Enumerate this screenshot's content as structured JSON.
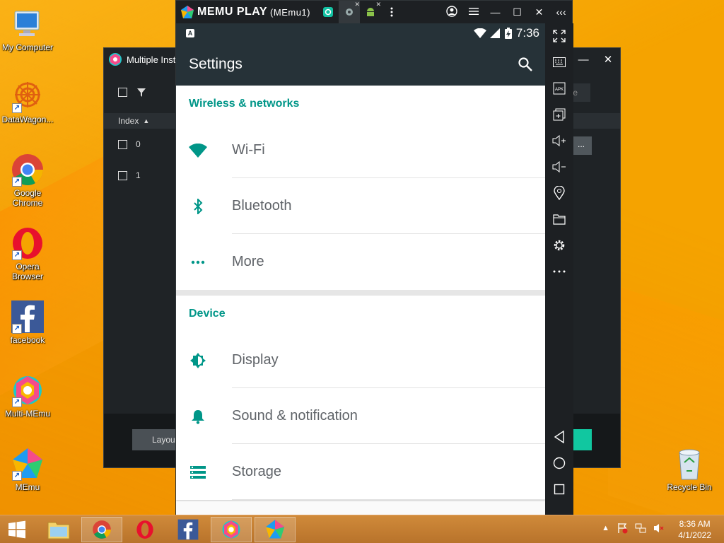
{
  "desktop": {
    "icons": [
      {
        "label": "My Computer"
      },
      {
        "label": "DataWagon..."
      },
      {
        "label": "Google Chrome"
      },
      {
        "label": "Opera Browser"
      },
      {
        "label": "facebook"
      },
      {
        "label": "Multi-MEmu"
      },
      {
        "label": "MEmu"
      },
      {
        "label": "Recycle Bin"
      }
    ]
  },
  "multi_window": {
    "title": "Multiple Insta",
    "column_index": "Index",
    "rows": [
      "0",
      "1"
    ],
    "layout_button": "Layout",
    "search_fragment": "te",
    "dots_button": "..."
  },
  "memu": {
    "brand": "MEMU PLAY",
    "instance": "(MEmu1)"
  },
  "android": {
    "status_time": "7:36",
    "status_badge": "A",
    "app_title": "Settings",
    "sections": [
      {
        "title": "Wireless & networks",
        "items": [
          {
            "label": "Wi-Fi",
            "icon": "wifi-icon"
          },
          {
            "label": "Bluetooth",
            "icon": "bluetooth-icon"
          },
          {
            "label": "More",
            "icon": "more-dots-icon"
          }
        ]
      },
      {
        "title": "Device",
        "items": [
          {
            "label": "Display",
            "icon": "brightness-icon"
          },
          {
            "label": "Sound & notification",
            "icon": "bell-icon"
          },
          {
            "label": "Storage",
            "icon": "storage-icon"
          }
        ]
      }
    ]
  },
  "taskbar": {
    "time": "8:36 AM",
    "date": "4/1/2022"
  },
  "colors": {
    "accent": "#009688",
    "appbar": "#263238",
    "desktop": "#f5a300"
  }
}
